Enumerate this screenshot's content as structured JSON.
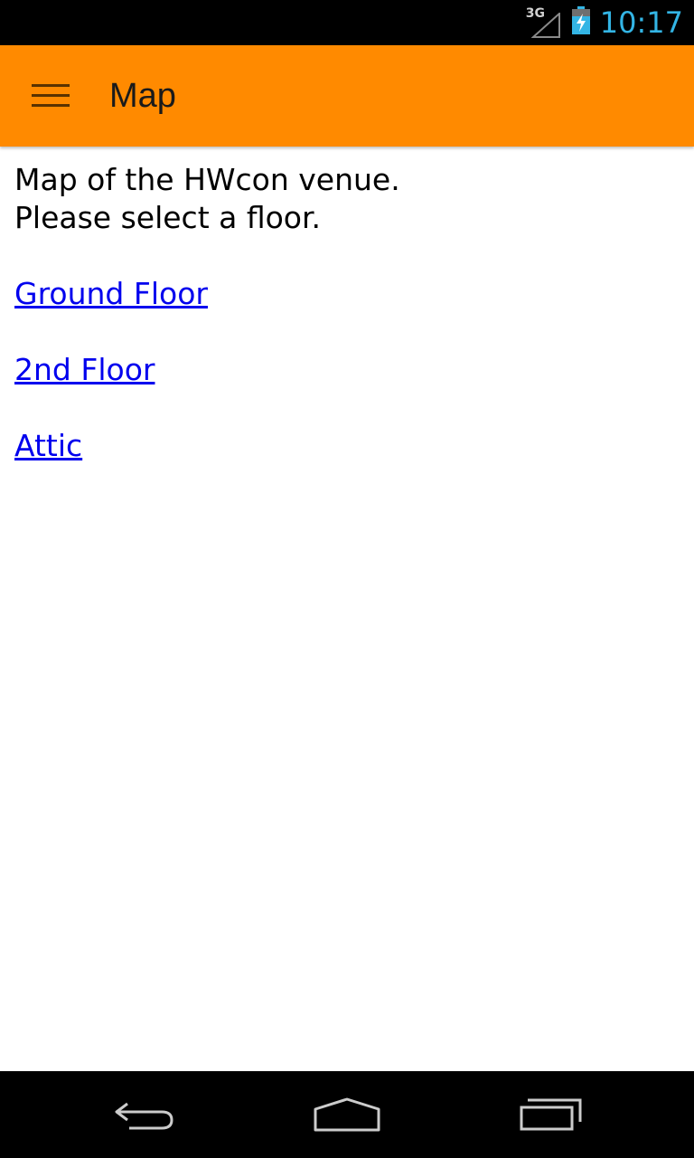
{
  "status_bar": {
    "network_label": "3G",
    "time": "10:17",
    "icons": [
      "signal-icon",
      "battery-charging-icon"
    ]
  },
  "app_bar": {
    "menu_icon": "hamburger-menu-icon",
    "title": "Map"
  },
  "content": {
    "intro_lines": [
      "Map of the HWcon venue.",
      "Please select a floor."
    ],
    "floor_links": [
      "Ground Floor",
      "2nd Floor",
      "Attic"
    ]
  },
  "nav_bar": {
    "icons": [
      "back-icon",
      "home-icon",
      "recents-icon"
    ]
  },
  "colors": {
    "app_bar": "#ff8a00",
    "clock": "#33b5e5",
    "link": "#0000ee"
  }
}
